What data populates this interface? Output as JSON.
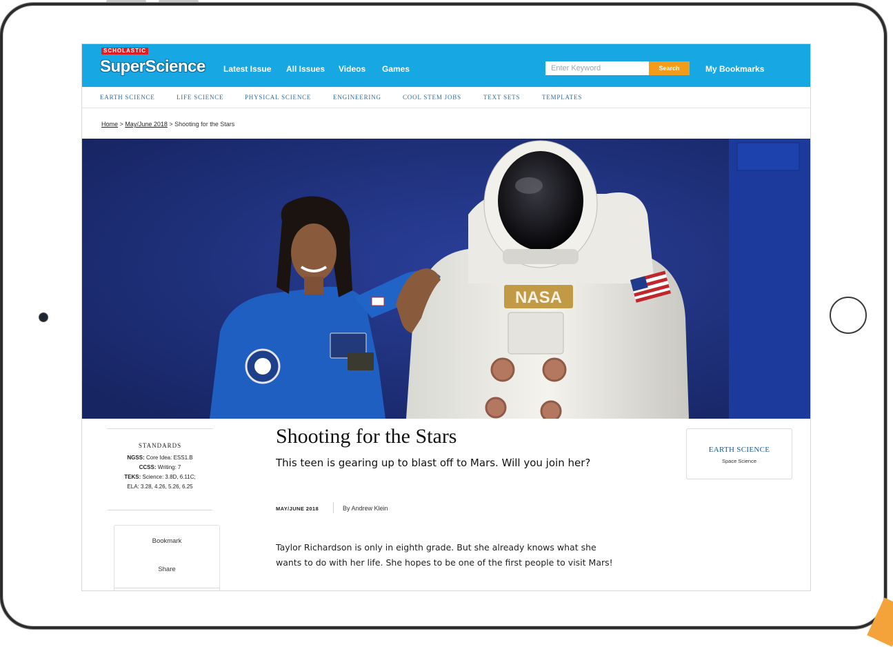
{
  "header": {
    "brand_small": "SCHOLASTIC",
    "brand_logo": "SuperScience",
    "nav": [
      "Latest Issue",
      "All Issues",
      "Videos",
      "Games"
    ],
    "search_placeholder": "Enter Keyword",
    "search_button": "Search",
    "bookmarks": "My Bookmarks"
  },
  "categories": [
    "EARTH SCIENCE",
    "LIFE SCIENCE",
    "PHYSICAL SCIENCE",
    "ENGINEERING",
    "COOL STEM JOBS",
    "TEXT SETS",
    "TEMPLATES"
  ],
  "breadcrumb": {
    "home": "Home",
    "sep1": ">",
    "issue": "May/June 2018",
    "sep2": ">",
    "current": "Shooting for the Stars"
  },
  "hero": {
    "suit_text": "NASA"
  },
  "standards": {
    "heading": "STANDARDS",
    "ngss_label": "NGSS:",
    "ngss_value": "Core Idea: ESS1.B",
    "ccss_label": "CCSS:",
    "ccss_value": "Writing: 7",
    "teks_label": "TEKS:",
    "teks_value": "Science: 3.8D, 6.11C;",
    "ela_value": "ELA: 3.28, 4.26, 5.26, 6.25"
  },
  "actions": {
    "bookmark": "Bookmark",
    "share": "Share"
  },
  "article": {
    "title": "Shooting for the Stars",
    "dek": "This teen is gearing up to blast off to Mars. Will you join her?",
    "issue": "MAY/JUNE 2018",
    "byline": "By Andrew Klein",
    "body": "Taylor Richardson is only in eighth grade. But she already knows what she wants to do with her life. She hopes to be one of the first people to visit Mars!"
  },
  "subject": {
    "title": "EARTH SCIENCE",
    "subtitle": "Space Science"
  },
  "colors": {
    "topbar": "#17a8e4",
    "search_button": "#f39c19",
    "category_link": "#2d6ea8",
    "hero_background": "#1d2f77",
    "brand_red": "#e31b23"
  }
}
